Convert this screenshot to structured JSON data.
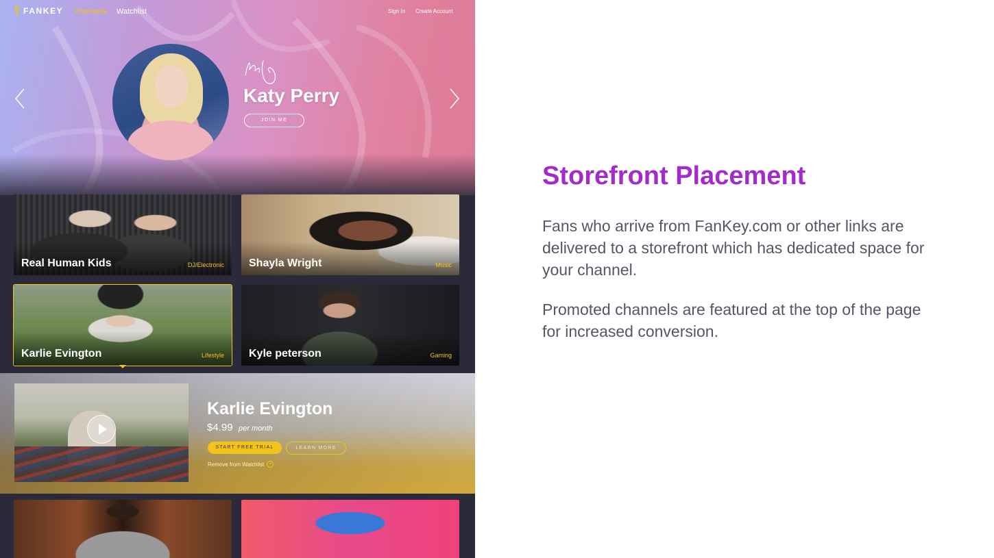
{
  "app": {
    "brand": "FANKEY",
    "nav": [
      {
        "label": "Channels",
        "active": true
      },
      {
        "label": "Watchlist",
        "active": false
      }
    ],
    "auth": {
      "sign_in": "Sign In",
      "create_account": "Create Account"
    },
    "accent_color": "#f4c31a",
    "hero": {
      "name": "Katy Perry",
      "cta": "JOIN ME"
    },
    "channels": [
      {
        "name": "Real Human Kids",
        "category": "DJ/Electronic"
      },
      {
        "name": "Shayla Wright",
        "category": "Music"
      },
      {
        "name": "Karlie Evington",
        "category": "Lifestyle",
        "selected": true
      },
      {
        "name": "Kyle peterson",
        "category": "Gaming"
      }
    ],
    "promo": {
      "name": "Karlie Evington",
      "price": "$4.99",
      "period": "per month",
      "primary_cta": "START FREE TRIAL",
      "secondary_cta": "LEARN MORE",
      "remove_link": "Remove from Watchlist"
    }
  },
  "slide": {
    "heading": "Storefront Placement",
    "heading_color": "#a32acb",
    "paragraphs": [
      "Fans who arrive from FanKey.com or other links are delivered to a storefront which has dedicated space for your channel.",
      "Promoted channels are featured at the top of the page for increased conversion."
    ]
  }
}
